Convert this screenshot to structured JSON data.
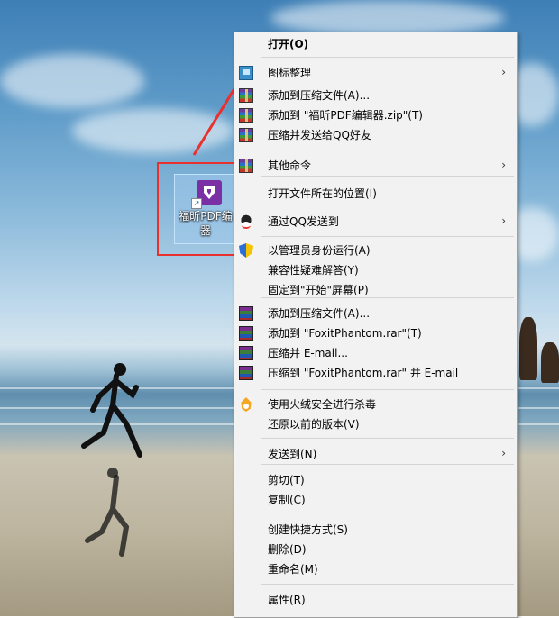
{
  "desktop_icon": {
    "name_line1": "福昕PDF编",
    "name_line2": "器"
  },
  "menu": {
    "items": [
      {
        "id": "open",
        "label": "打开(O)",
        "bold": true,
        "icon": "",
        "submenu": false
      },
      {
        "id": "icon-organize",
        "label": "图标整理",
        "icon": "monitor-icon",
        "submenu": true
      },
      {
        "id": "add-archive-1",
        "label": "添加到压缩文件(A)...",
        "icon": "winrar-icon",
        "submenu": false
      },
      {
        "id": "add-zip",
        "label": "添加到 \"福昕PDF编辑器.zip\"(T)",
        "icon": "winrar-icon",
        "submenu": false
      },
      {
        "id": "compress-qq",
        "label": "压缩并发送给QQ好友",
        "icon": "winrar-icon",
        "submenu": false
      },
      {
        "id": "other-commands",
        "label": "其他命令",
        "icon": "winrar-icon",
        "submenu": true
      },
      {
        "id": "open-location",
        "label": "打开文件所在的位置(I)",
        "icon": "",
        "submenu": false
      },
      {
        "id": "send-qq",
        "label": "通过QQ发送到",
        "icon": "qq-icon",
        "submenu": true
      },
      {
        "id": "run-admin",
        "label": "以管理员身份运行(A)",
        "icon": "shield-icon",
        "submenu": false
      },
      {
        "id": "compat",
        "label": "兼容性疑难解答(Y)",
        "icon": "",
        "submenu": false
      },
      {
        "id": "pin-start",
        "label": "固定到\"开始\"屏幕(P)",
        "icon": "",
        "submenu": false
      },
      {
        "id": "add-archive-2",
        "label": "添加到压缩文件(A)...",
        "icon": "winrar-stack-icon",
        "submenu": false
      },
      {
        "id": "add-rar",
        "label": "添加到 \"FoxitPhantom.rar\"(T)",
        "icon": "winrar-stack-icon",
        "submenu": false
      },
      {
        "id": "compress-email",
        "label": "压缩并 E-mail...",
        "icon": "winrar-stack-icon",
        "submenu": false
      },
      {
        "id": "compress-rar-email",
        "label": "压缩到 \"FoxitPhantom.rar\" 并 E-mail",
        "icon": "winrar-stack-icon",
        "submenu": false
      },
      {
        "id": "huorong",
        "label": "使用火绒安全进行杀毒",
        "icon": "huorong-icon",
        "submenu": false
      },
      {
        "id": "restore",
        "label": "还原以前的版本(V)",
        "icon": "",
        "submenu": false
      },
      {
        "id": "send-to",
        "label": "发送到(N)",
        "icon": "",
        "submenu": true
      },
      {
        "id": "cut",
        "label": "剪切(T)",
        "icon": "",
        "submenu": false
      },
      {
        "id": "copy",
        "label": "复制(C)",
        "icon": "",
        "submenu": false
      },
      {
        "id": "create-shortcut",
        "label": "创建快捷方式(S)",
        "icon": "",
        "submenu": false
      },
      {
        "id": "delete",
        "label": "删除(D)",
        "icon": "",
        "submenu": false
      },
      {
        "id": "rename",
        "label": "重命名(M)",
        "icon": "",
        "submenu": false
      },
      {
        "id": "properties",
        "label": "属性(R)",
        "icon": "",
        "submenu": false
      }
    ],
    "submenu_glyph": "›"
  },
  "colors": {
    "annotation_red": "#e8312d",
    "menu_bg": "#f2f2f2",
    "app_purple": "#7b2fa5"
  }
}
